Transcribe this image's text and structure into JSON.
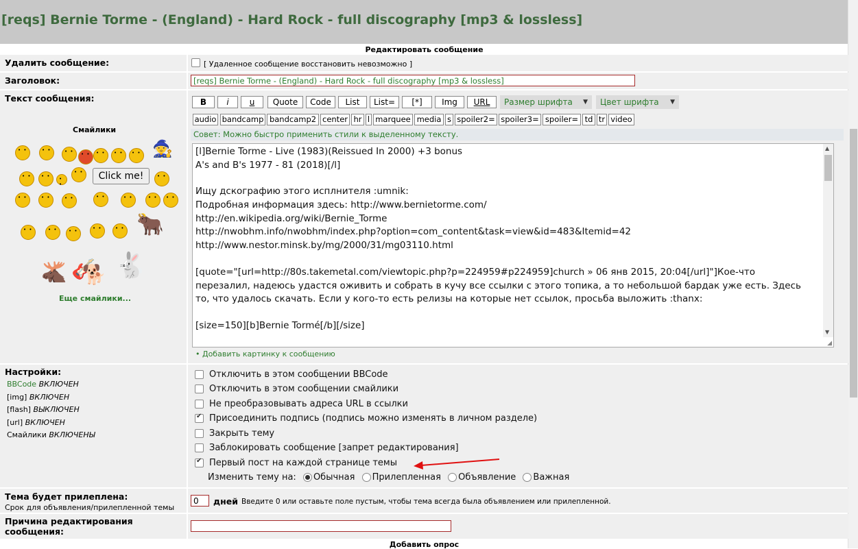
{
  "topic": {
    "title": "[reqs] Bernie Torme - (England) - Hard Rock - full discography [mp3 & lossless]"
  },
  "form": {
    "title": "Редактировать сообщение",
    "delete": {
      "label": "Удалить сообщение:",
      "note": "[ Удаленное сообщение восстановить невозможно ]"
    },
    "subject": {
      "label": "Заголовок:",
      "value": "[reqs] Bernie Torme - (England) - Hard Rock - full discography [mp3 & lossless]"
    },
    "message": {
      "label": "Текст сообщения:"
    },
    "smilies": {
      "title": "Смайлики",
      "click_me": "Click me!",
      "more": "Еще смайлики..."
    },
    "toolbar": {
      "row1": [
        "B",
        "i",
        "u",
        "Quote",
        "Code",
        "List",
        "List=",
        "[*]",
        "Img",
        "URL"
      ],
      "font_size": "Размер шрифта",
      "font_color": "Цвет шрифта",
      "row2": [
        "audio",
        "bandcamp",
        "bandcamp2",
        "center",
        "hr",
        "l",
        "marquee",
        "media",
        "s",
        "spoiler2=",
        "spoiler3=",
        "spoiler=",
        "td",
        "tr",
        "video"
      ]
    },
    "hint": "Совет: Можно быстро применить стили к выделенному тексту.",
    "body_lines": [
      "[l]Bernie Torme - Live (1983)(Reissued In 2000) +3 bonus",
      "A's and B's 1977 - 81 (2018)[/l]",
      "",
      "Ищу дскографию этого исплнителя  :umnik:",
      "Подробная информация здесь: http://www.bernietorme.com/",
      "http://en.wikipedia.org/wiki/Bernie_Torme",
      "http://nwobhm.info/nwobhm/index.php?option=com_content&task=view&id=483&Itemid=42",
      "http://www.nestor.minsk.by/mg/2000/31/mg03110.html",
      "",
      "[quote=\"[url=http://80s.takemetal.com/viewtopic.php?p=224959#p224959]church » 06 янв 2015, 20:04[/url]\"]Кое-что",
      "перезалил, надеюсь удастся оживить и собрать в кучу все ссылки с этого топика, а то небольшой бардак уже есть. Здесь",
      "то, что удалось скачать. Если у кого-то есть релизы на которые нет ссылок, просьба выложить :thanx:",
      "",
      "[size=150][b]Bernie Tormé[/b][/size]"
    ],
    "add_image": "• Добавить картинку к сообщению",
    "settings": {
      "label": "Настройки:",
      "items": [
        {
          "name": "BBCode",
          "state": "ВКЛЮЧЕН"
        },
        {
          "name": "[img]",
          "state": "ВКЛЮЧЕН"
        },
        {
          "name": "[flash]",
          "state": "ВЫКЛЮЧЕН"
        },
        {
          "name": "[url]",
          "state": "ВКЛЮЧЕН"
        },
        {
          "name": "Смайлики",
          "state": "ВКЛЮЧЕНЫ"
        }
      ]
    },
    "options": [
      {
        "label": "Отключить в этом сообщении BBCode",
        "checked": false
      },
      {
        "label": "Отключить в этом сообщении смайлики",
        "checked": false
      },
      {
        "label": "Не преобразовывать адреса URL в ссылки",
        "checked": false
      },
      {
        "label": "Присоединить подпись (подпись можно изменять в личном разделе)",
        "checked": true
      },
      {
        "label": "Закрыть тему",
        "checked": false
      },
      {
        "label": "Заблокировать сообщение [запрет редактирования]",
        "checked": false
      },
      {
        "label": "Первый пост на каждой странице темы",
        "checked": true
      }
    ],
    "change_topic": {
      "label": "Изменить тему на:",
      "options": [
        "Обычная",
        "Прилепленная",
        "Объявление",
        "Важная"
      ],
      "selected": "Обычная"
    },
    "sticky": {
      "label": "Тема будет прилеплена:",
      "sublabel": "Срок для объявления/прилепленной темы",
      "value": "0",
      "unit": "дней",
      "note": "Введите 0 или оставьте поле пустым, чтобы тема всегда была объявлением или прилепленной."
    },
    "reason": {
      "label_1": "Причина редактирования",
      "label_2": "сообщения:"
    },
    "add_poll": "Добавить опрос"
  },
  "colors": {
    "accent_green": "#2e7d2e",
    "title_green": "#3e6a3e",
    "arrow_red": "#e01010"
  }
}
